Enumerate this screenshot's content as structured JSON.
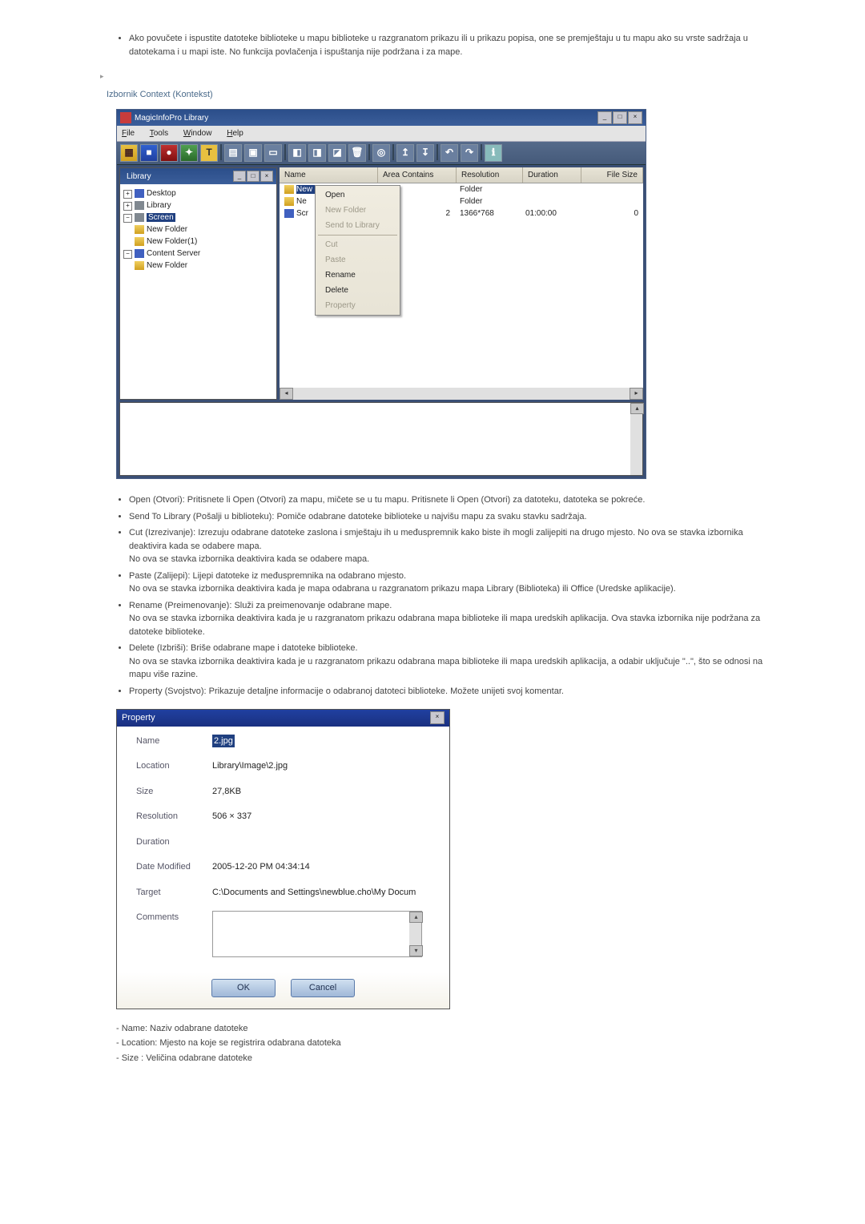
{
  "doc": {
    "intro_bullet": "Ako povučete i ispustite datoteke biblioteke u mapu biblioteke u razgranatom prikazu ili u prikazu popisa, one se premještaju u tu mapu ako su vrste sadržaja u datotekama i u mapi iste. No funkcija povlačenja i ispuštanja nije podržana i za mape.",
    "heading": "Izbornik Context (Kontekst)",
    "descr": [
      {
        "t": "Open (Otvori): Pritisnete li Open (Otvori) za mapu, mičete se u tu mapu. Pritisnete li Open (Otvori) za datoteku, datoteka se pokreće."
      },
      {
        "t": "Send To Library (Pošalji u biblioteku): Pomiče odabrane datoteke biblioteke u najvišu mapu za svaku stavku sadržaja."
      },
      {
        "t": "Cut (Izrezivanje): Izrezuju odabrane datoteke zaslona i smještaju ih u međuspremnik kako biste ih mogli zalijepiti na drugo mjesto. No ova se stavka izbornika deaktivira kada se odabere mapa.",
        "extra": "No ova se stavka izbornika deaktivira kada se odabere mapa."
      },
      {
        "t": "Paste (Zalijepi): Lijepi datoteke iz međuspremnika na odabrano mjesto.",
        "extra": "No ova se stavka izbornika deaktivira kada je mapa odabrana u razgranatom prikazu mapa Library (Biblioteka) ili Office (Uredske aplikacije)."
      },
      {
        "t": "Rename (Preimenovanje): Služi za preimenovanje odabrane mape.",
        "extra": "No ova se stavka izbornika deaktivira kada je u razgranatom prikazu odabrana mapa biblioteke ili mapa uredskih aplikacija. Ova stavka izbornika nije podržana za datoteke biblioteke."
      },
      {
        "t": "Delete (Izbriši): Briše odabrane mape i datoteke biblioteke.",
        "extra": "No ova se stavka izbornika deaktivira kada je u razgranatom prikazu odabrana mapa biblioteke ili mapa uredskih aplikacija, a odabir uključuje \"..\", što se odnosi na mapu više razine."
      },
      {
        "t": "Property (Svojstvo): Prikazuje detaljne informacije o odabranoj datoteci biblioteke. Možete unijeti svoj komentar."
      }
    ],
    "dashes": [
      "- Name: Naziv odabrane datoteke",
      "- Location: Mjesto na koje se registrira odabrana datoteka",
      "- Size : Veličina odabrane datoteke"
    ]
  },
  "win": {
    "title": "MagicInfoPro Library",
    "menu": {
      "file": "File",
      "tools": "Tools",
      "window": "Window",
      "help": "Help"
    },
    "library_pane": {
      "title": "Library",
      "nodes": {
        "desktop": "Desktop",
        "library": "Library",
        "screen": "Screen",
        "nf": "New Folder",
        "nf1": "New Folder(1)",
        "cs": "Content Server",
        "nf2": "New Folder"
      }
    },
    "cols": {
      "name": "Name",
      "area": "Area Contains",
      "res": "Resolution",
      "dur": "Duration",
      "size": "File Size"
    },
    "rows": {
      "r0": {
        "name": "New Folder",
        "res": "Folder"
      },
      "r1": {
        "name": "Ne",
        "res": "Folder"
      },
      "r2": {
        "name": "Scr",
        "area": "2",
        "res": "1366*768",
        "dur": "01:00:00",
        "size": "0"
      }
    },
    "ctx": {
      "open": "Open",
      "newfolder": "New Folder",
      "sendlib": "Send to Library",
      "cut": "Cut",
      "paste": "Paste",
      "rename": "Rename",
      "delete": "Delete",
      "property": "Property"
    }
  },
  "prop": {
    "title": "Property",
    "labels": {
      "name": "Name",
      "location": "Location",
      "size": "Size",
      "resolution": "Resolution",
      "duration": "Duration",
      "datemod": "Date Modified",
      "target": "Target",
      "comments": "Comments"
    },
    "vals": {
      "name": "2.jpg",
      "location": "Library\\Image\\2.jpg",
      "size": "27,8KB",
      "resolution": "506 × 337",
      "duration": "",
      "datemod": "2005-12-20 PM 04:34:14",
      "target": "C:\\Documents and Settings\\newblue.cho\\My Docum"
    },
    "ok": "OK",
    "cancel": "Cancel"
  }
}
